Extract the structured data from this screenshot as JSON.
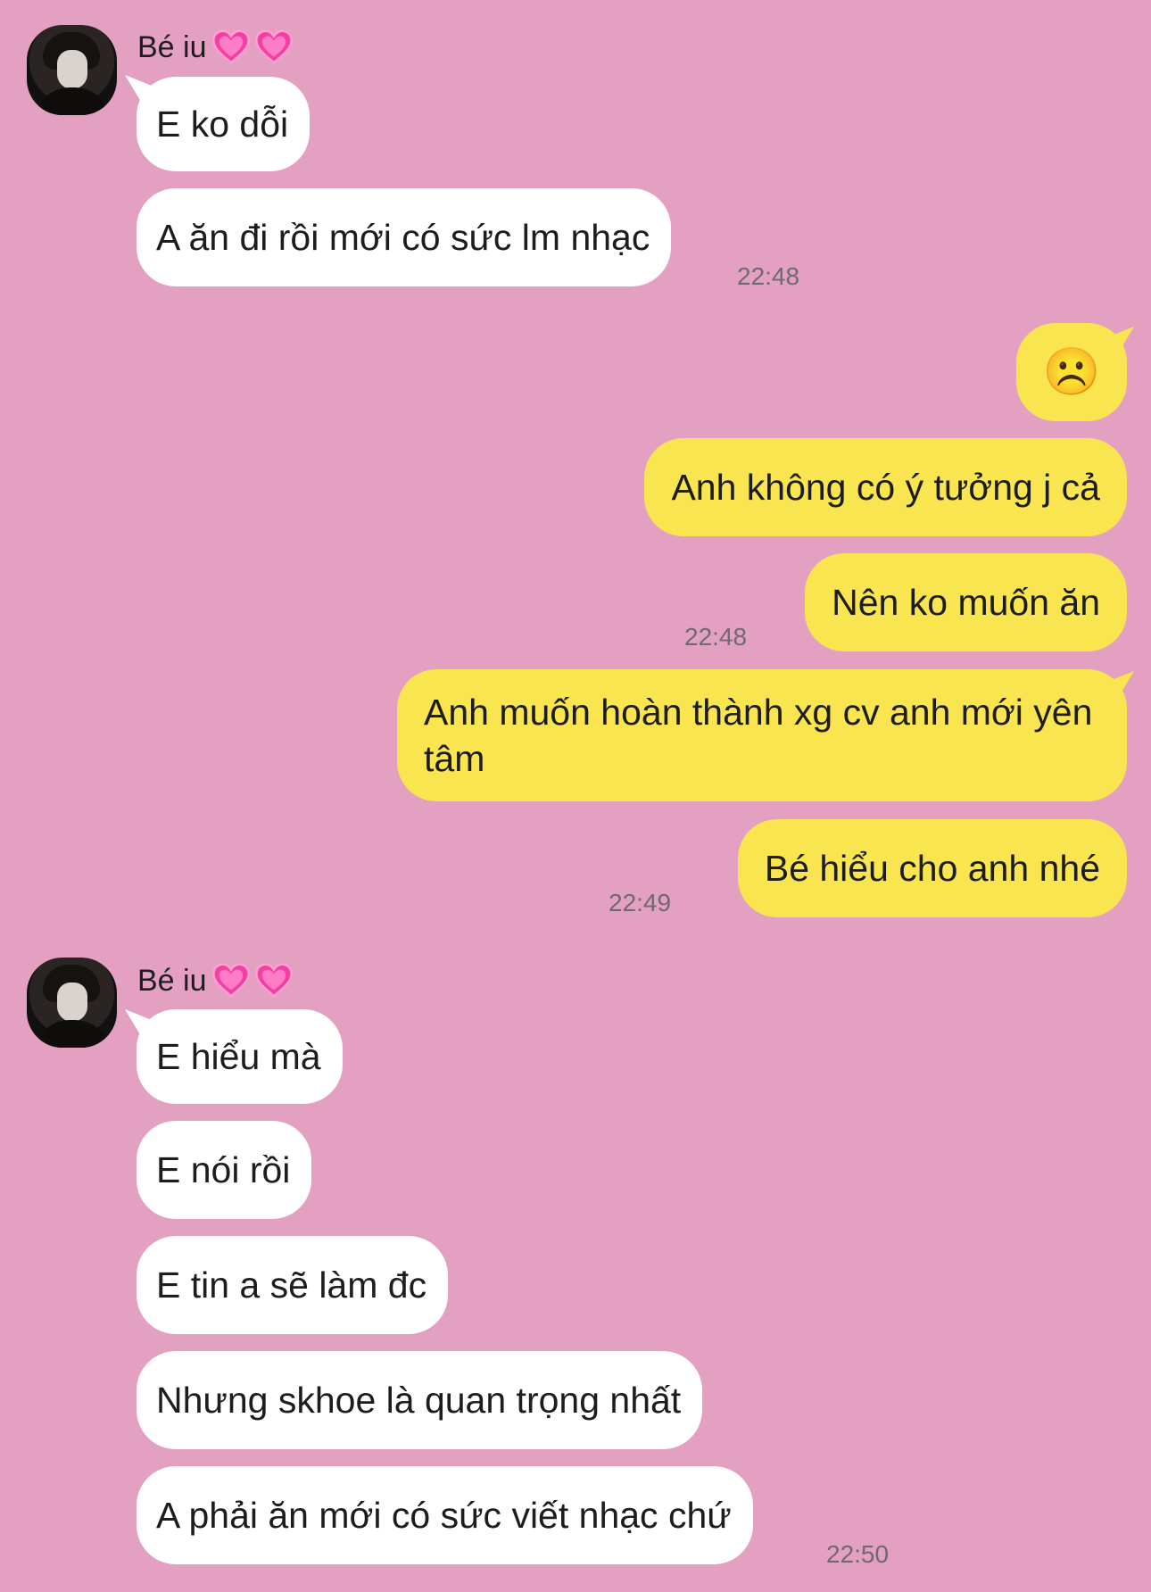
{
  "contact": {
    "name": "Bé iu",
    "name_emoji": "💗💗"
  },
  "messages": {
    "m1": "E ko dỗi",
    "m2": "A ăn đi rồi mới có sức lm nhạc",
    "t1": "22:48",
    "m3": "☹️",
    "m4": "Anh không có ý tưởng j cả",
    "m5": "Nên ko muốn ăn",
    "t2": "22:48",
    "m6": "Anh muốn hoàn thành xg cv anh mới yên tâm",
    "m7": "Bé hiểu cho anh nhé",
    "t3": "22:49",
    "m8": "E hiểu mà",
    "m9": "E nói rồi",
    "m10": "E tin a sẽ làm đc",
    "m11": "Nhưng skhoe là quan trọng nhất",
    "m12": "A phải ăn mới có sức viết nhạc chứ",
    "t4": "22:50"
  },
  "colors": {
    "background": "#e4a0c1",
    "incoming_bubble": "#ffffff",
    "outgoing_bubble": "#f9e54f"
  }
}
